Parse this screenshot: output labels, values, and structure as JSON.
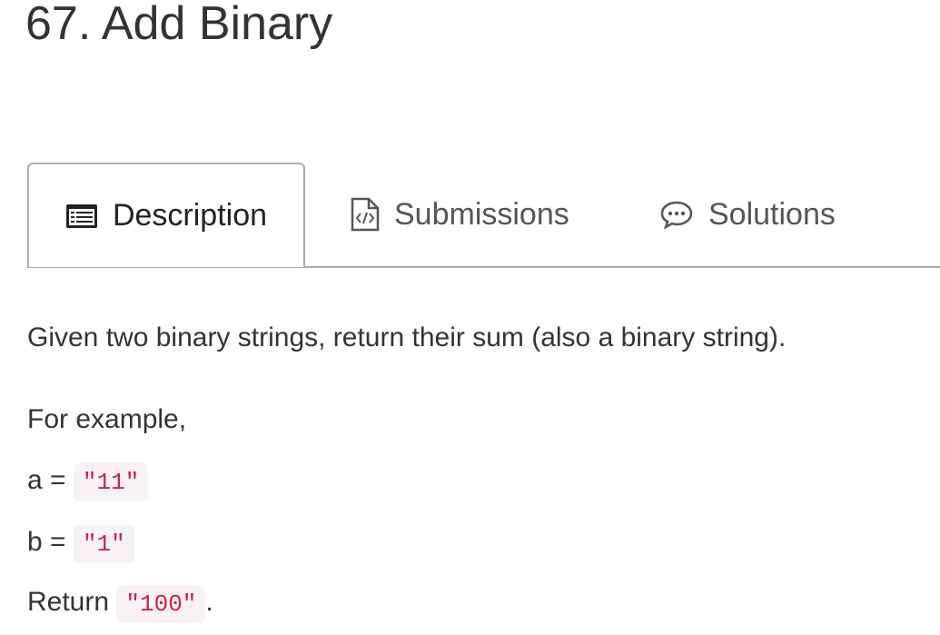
{
  "title": "67. Add Binary",
  "tabs": [
    {
      "label": "Description",
      "icon": "list-card-icon",
      "active": true
    },
    {
      "label": "Submissions",
      "icon": "code-file-icon",
      "active": false
    },
    {
      "label": "Solutions",
      "icon": "chat-bubble-icon",
      "active": false
    }
  ],
  "content": {
    "intro": "Given two binary strings, return their sum (also a binary string).",
    "example_label": "For example,",
    "a_label": "a =",
    "a_value": "\"11\"",
    "b_label": "b =",
    "b_value": "\"1\"",
    "return_label": "Return",
    "return_value": "\"100\"",
    "return_suffix": "."
  },
  "colors": {
    "code_text": "#c7254e",
    "code_bg": "#f9f2f4",
    "border": "#aaaaaa"
  }
}
